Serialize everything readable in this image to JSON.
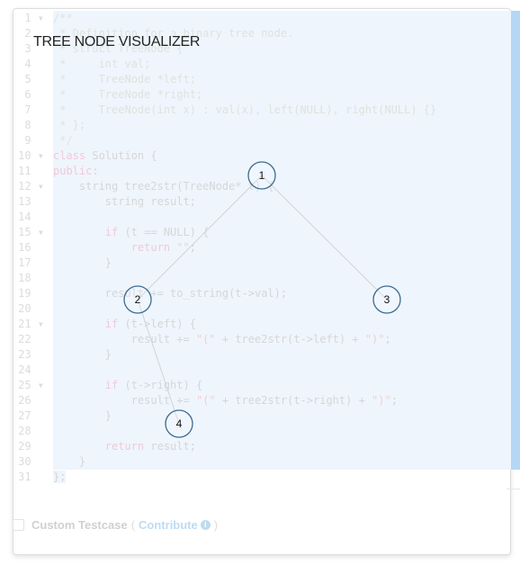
{
  "title": "TREE NODE VISUALIZER",
  "editor": {
    "lines": [
      "/**",
      " * Definition for a binary tree node.",
      " * struct TreeNode {",
      " *     int val;",
      " *     TreeNode *left;",
      " *     TreeNode *right;",
      " *     TreeNode(int x) : val(x), left(NULL), right(NULL) {}",
      " * };",
      " */",
      "class Solution {",
      "public:",
      "    string tree2str(TreeNode* t) {",
      "        string result;",
      "",
      "        if (t == NULL) {",
      "            return \"\";",
      "        }",
      "",
      "        result += to_string(t->val);",
      "",
      "        if (t->left) {",
      "            result += \"(\" + tree2str(t->left) + \")\";",
      "        }",
      "",
      "        if (t->right) {",
      "            result += \"(\" + tree2str(t->right) + \")\";",
      "        }",
      "",
      "        return result;",
      "    }",
      "};"
    ],
    "fold_lines": [
      1,
      10,
      12,
      15,
      21,
      25
    ]
  },
  "tree": {
    "nodes": [
      {
        "id": 1,
        "label": "1"
      },
      {
        "id": 2,
        "label": "2"
      },
      {
        "id": 3,
        "label": "3"
      },
      {
        "id": 4,
        "label": "4"
      }
    ],
    "edges": [
      [
        1,
        2
      ],
      [
        1,
        3
      ],
      [
        2,
        4
      ]
    ],
    "node_stroke": "#3d6b8f",
    "edge_color": "#d3d3d3"
  },
  "footer": {
    "custom_testcase": "Custom Testcase",
    "open_paren": "(",
    "contribute": "Contribute",
    "info_icon": "i",
    "close_paren": ")"
  }
}
